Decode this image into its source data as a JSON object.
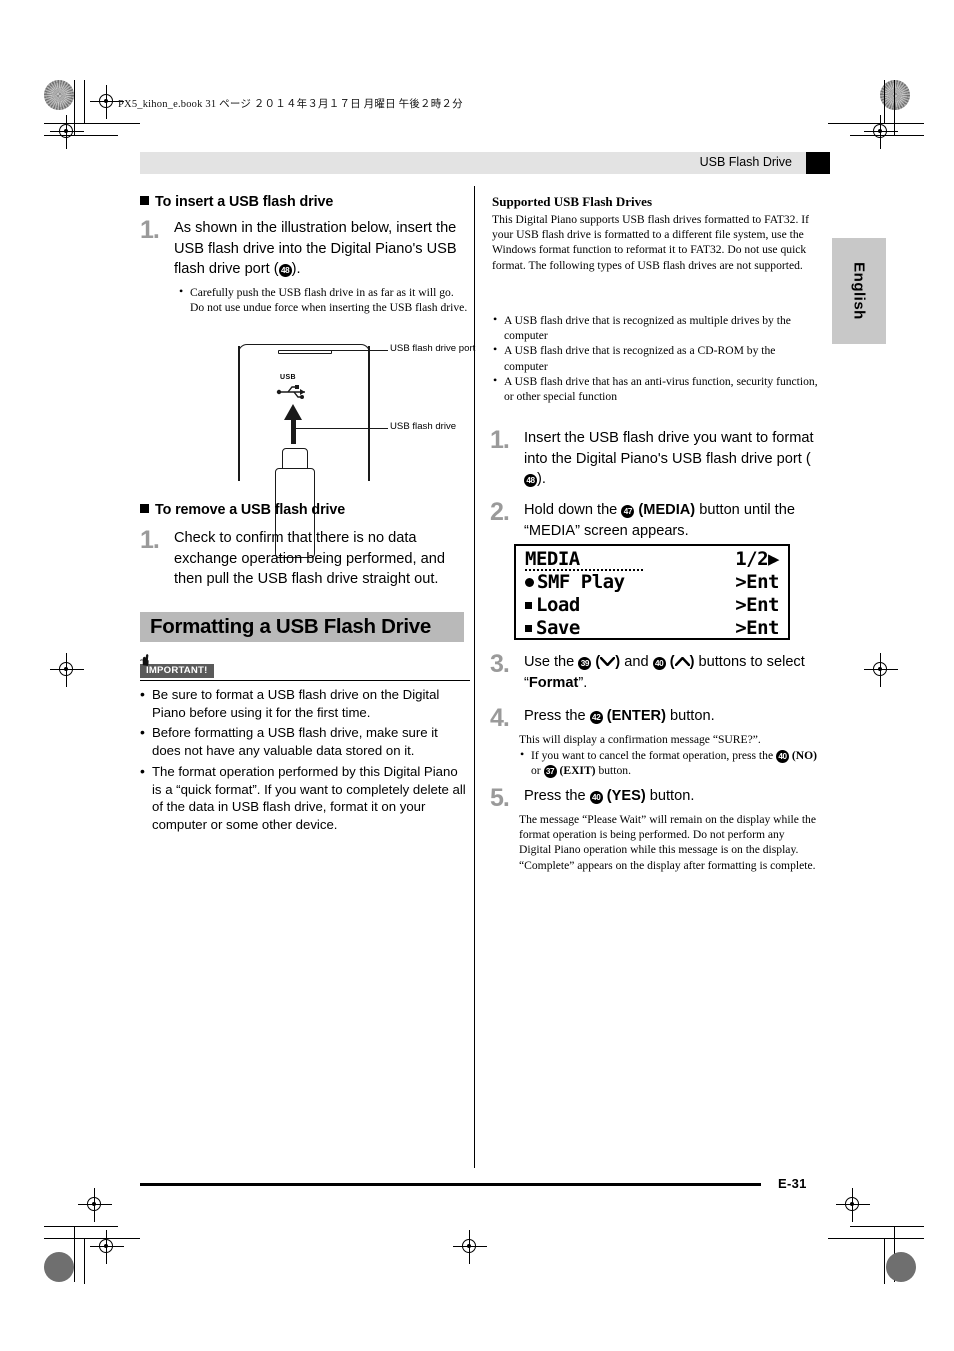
{
  "print_marks": {
    "book_line": "PX5_kihon_e.book   31 ページ   ２０１４年３月１７日   月曜日   午後２時２分"
  },
  "header": {
    "title": "USB Flash Drive"
  },
  "language_tab": {
    "label": "English"
  },
  "footer": {
    "page_number": "E-31"
  },
  "left_column": {
    "insert_section": {
      "heading": "To insert a USB flash drive",
      "step1_number": "1.",
      "step1_text_a": "As shown in the illustration below, insert the USB flash drive into the Digital Piano's USB flash drive port (",
      "step1_ref": "48",
      "step1_text_b": ").",
      "note": "Carefully push the USB flash drive in as far as it will go. Do not use undue force when inserting the USB flash drive."
    },
    "illustration": {
      "usb_label": "USB",
      "callout_port": "USB flash drive port",
      "callout_drive": "USB flash drive"
    },
    "remove_section": {
      "heading": "To remove a USB flash drive",
      "step1_number": "1.",
      "step1_text": "Check to confirm that there is no data exchange operation being performed, and then pull the USB flash drive straight out."
    },
    "format_section": {
      "banner_title": "Formatting a USB Flash Drive",
      "important_badge": "IMPORTANT!",
      "important_items": [
        "Be sure to format a USB flash drive on the Digital Piano before using it for the first time.",
        "Before formatting a USB flash drive, make sure it does not have any valuable data stored on it.",
        "The format operation performed by this Digital Piano is a “quick format”. If you want to completely delete all of the data in USB flash drive, format it on your computer or some other device."
      ]
    }
  },
  "right_column": {
    "supported": {
      "heading": "Supported USB Flash Drives",
      "body": "This Digital Piano supports USB flash drives formatted to FAT32. If your USB flash drive is formatted to a different file system, use the Windows format function to reformat it to FAT32. Do not use quick format. The following types of USB flash drives are not supported.",
      "items": [
        "A USB flash drive that is recognized as multiple drives by the computer",
        "A USB flash drive that is recognized as a CD-ROM by the computer",
        "A USB flash drive that has an anti-virus function, security function, or other special function"
      ]
    },
    "steps": {
      "s1_number": "1.",
      "s1_text_a": "Insert the USB flash drive you want to format into the Digital Piano's USB flash drive port (",
      "s1_ref": "48",
      "s1_text_b": ").",
      "s2_number": "2.",
      "s2_text_a": "Hold down the ",
      "s2_ref": "47",
      "s2_bold": "(MEDIA)",
      "s2_text_b": " button until the “MEDIA” screen appears.",
      "s3_number": "3.",
      "s3_text_a": "Use the ",
      "s3_ref1": "39",
      "s3_sym1": "(＿)",
      "s3_text_b": " and ",
      "s3_ref2": "40",
      "s3_sym2": "(＿)",
      "s3_text_c": " buttons to select “",
      "s3_bold": "Format",
      "s3_text_d": "”.",
      "s4_number": "4.",
      "s4_text_a": "Press the ",
      "s4_ref": "42",
      "s4_bold": "(ENTER)",
      "s4_text_b": " button.",
      "s4_note_line": "This will display a confirmation message “SURE?”.",
      "s4_note_bullet_a": "If you want to cancel the format operation, press the ",
      "s4_note_ref1": "40",
      "s4_note_bold1": "(NO)",
      "s4_note_mid": " or ",
      "s4_note_ref2": "37",
      "s4_note_bold2": "(EXIT)",
      "s4_note_end": " button.",
      "s5_number": "5.",
      "s5_text_a": "Press the ",
      "s5_ref": "40",
      "s5_bold": "(YES)",
      "s5_text_b": " button.",
      "s5_note": "The message “Please Wait” will remain on the display while the format operation is being performed. Do not perform any Digital Piano operation while this message is on the display. “Complete” appears on the display after formatting is complete."
    },
    "lcd_screen": {
      "title": "MEDIA",
      "page_indicator": "1/2▶",
      "rows": [
        {
          "label": "SMF Play",
          "value": ">Ent"
        },
        {
          "label": "Load",
          "value": ">Ent"
        },
        {
          "label": "Save",
          "value": ">Ent"
        }
      ]
    }
  }
}
